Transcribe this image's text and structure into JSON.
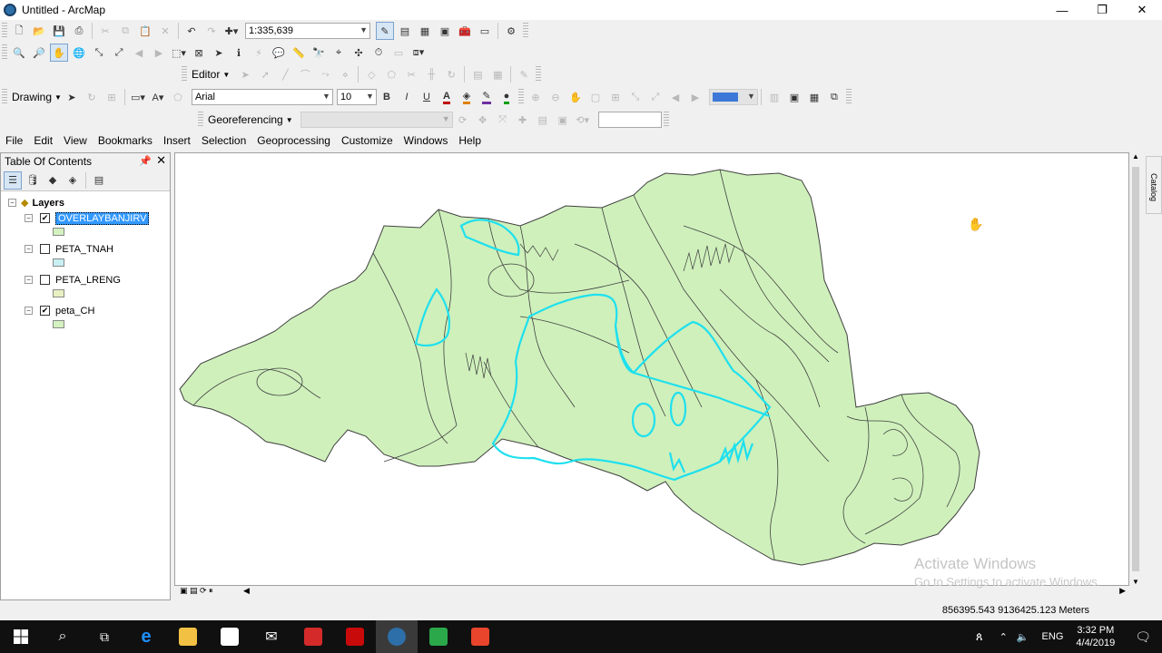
{
  "window": {
    "title": "Untitled - ArcMap",
    "controls": [
      "—",
      "❐",
      "✕"
    ]
  },
  "standard_toolbar": {
    "scale": "1:335,639"
  },
  "editor_toolbar": {
    "label": "Editor"
  },
  "drawing_toolbar": {
    "label": "Drawing",
    "font": "Arial",
    "size": "10",
    "bold": "B",
    "italic": "I",
    "underline": "U"
  },
  "georef_toolbar": {
    "label": "Georeferencing"
  },
  "menu": [
    "File",
    "Edit",
    "View",
    "Bookmarks",
    "Insert",
    "Selection",
    "Geoprocessing",
    "Customize",
    "Windows",
    "Help"
  ],
  "toc": {
    "title": "Table Of Contents",
    "root": "Layers",
    "layers": [
      {
        "name": "OVERLAYBANJIRV",
        "checked": true,
        "selected": true,
        "swatch": "#d3f2c0"
      },
      {
        "name": "PETA_TNAH",
        "checked": false,
        "selected": false,
        "swatch": "#c8f0f4"
      },
      {
        "name": "PETA_LRENG",
        "checked": false,
        "selected": false,
        "swatch": "#e8f0c2"
      },
      {
        "name": "peta_CH",
        "checked": true,
        "selected": false,
        "swatch": "#d3f2c0"
      }
    ]
  },
  "catalog_tab": "Catalog",
  "map": {
    "fill": "#cff0bb",
    "outline": "#404040",
    "overlay": "#1ee0ee"
  },
  "status": {
    "coordinates": "856395.543  9136425.123 Meters"
  },
  "watermark": {
    "line1": "Activate Windows",
    "line2": "Go to Settings to activate Windows."
  },
  "taskbar": {
    "time": "3:32 PM",
    "date": "4/4/2019",
    "lang": "ENG"
  }
}
